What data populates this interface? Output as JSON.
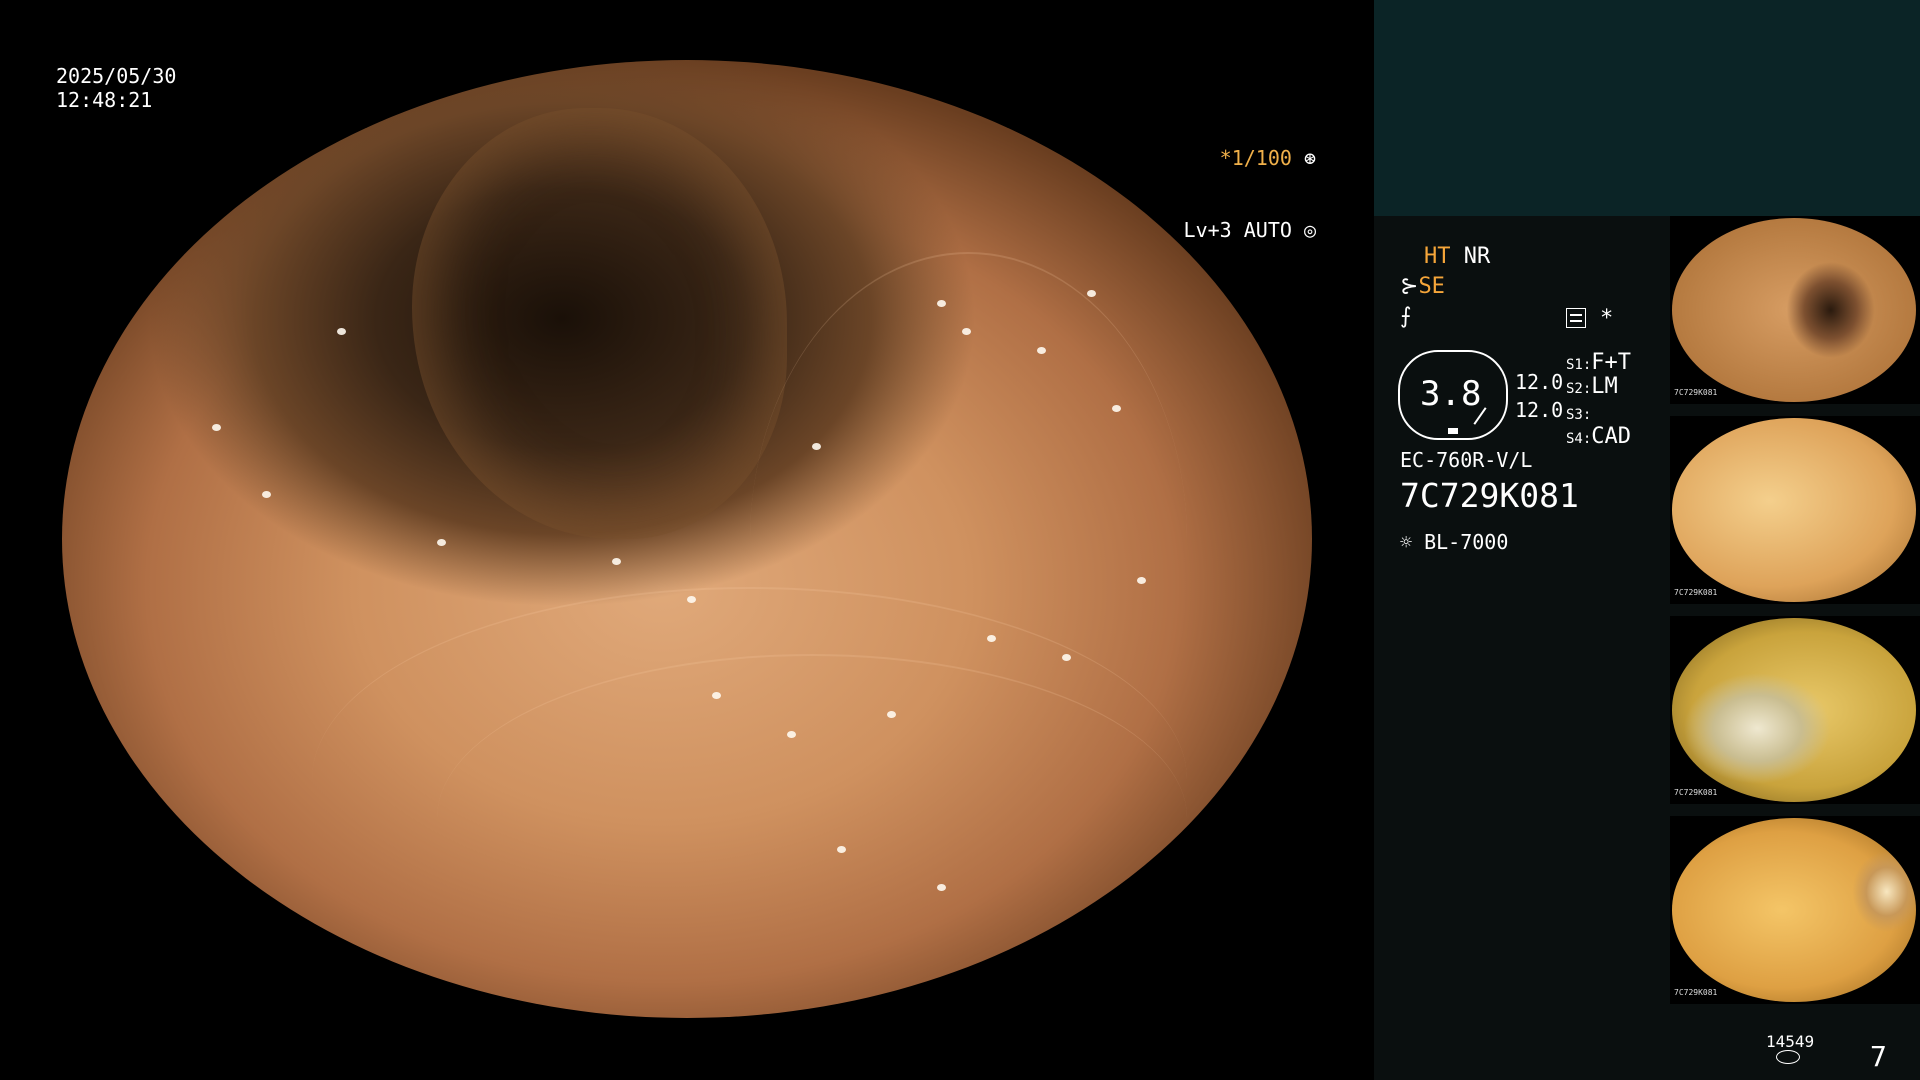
{
  "overlay": {
    "date": "2025/05/30",
    "time": "12:48:21",
    "shutter": "*1/100",
    "shutter_icon": "aperture-icon",
    "level": "Lv+3 AUTO",
    "level_icon": "iris-icon"
  },
  "info": {
    "ht": "HT",
    "nr": "NR",
    "se": "SE",
    "se_icon": "probe-icon",
    "f_icon": "filter-icon",
    "settings_icon": "settings-icon",
    "asterisk": "*",
    "gauge_value": "3.8",
    "gauge_right_1": "12.0",
    "gauge_right_2": "12.0",
    "s1_label": "S1:",
    "s1_value": "F+T",
    "s2_label": "S2:",
    "s2_value": "LM",
    "s3_label": "S3:",
    "s3_value": "",
    "s4_label": "S4:",
    "s4_value": "CAD",
    "scope_model": "EC-760R-V/L",
    "serial": "7C729K081",
    "light_icon": "light-source-icon",
    "light_source": "BL-7000"
  },
  "thumbnails": [
    {
      "caption": "7C729K081"
    },
    {
      "caption": "7C729K081"
    },
    {
      "caption": "7C729K081"
    },
    {
      "caption": "7C729K081"
    }
  ],
  "footer": {
    "storage_count": "14549",
    "storage_icon": "storage-icon",
    "image_count": "7"
  }
}
